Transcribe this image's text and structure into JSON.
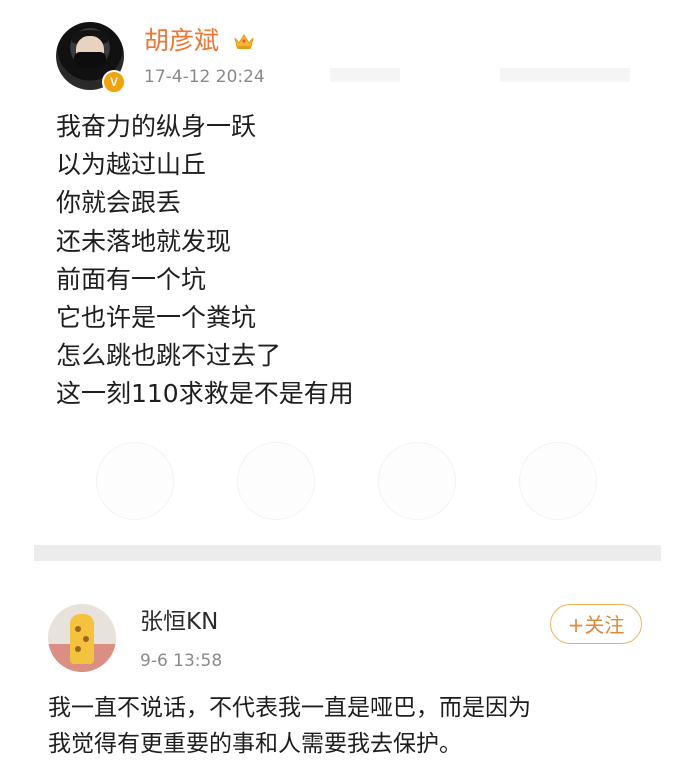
{
  "post1": {
    "username": "胡彦斌",
    "timestamp": "17-4-12 20:24",
    "verified_badge": "V",
    "badge_icon": "crown-icon",
    "lines": [
      "我奋力的纵身一跃",
      "以为越过山丘",
      "你就会跟丢",
      "还未落地就发现",
      "前面有一个坑",
      "它也许是一个粪坑",
      "怎么跳也跳不过去了",
      "这一刻110求救是不是有用"
    ]
  },
  "post2": {
    "username": "张恒KN",
    "timestamp": "9-6 13:58",
    "follow_label": "+关注",
    "comment_lines": [
      "我一直不说话，不代表我一直是哑巴，而是因为",
      "我觉得有更重要的事和人需要我去保护。"
    ]
  },
  "colors": {
    "username_accent": "#ee7633",
    "timestamp": "#8a8a8a",
    "follow_border": "#f0b15c",
    "follow_text": "#e0883a",
    "divider": "#ececec",
    "verified_badge": "#f2a20c"
  }
}
